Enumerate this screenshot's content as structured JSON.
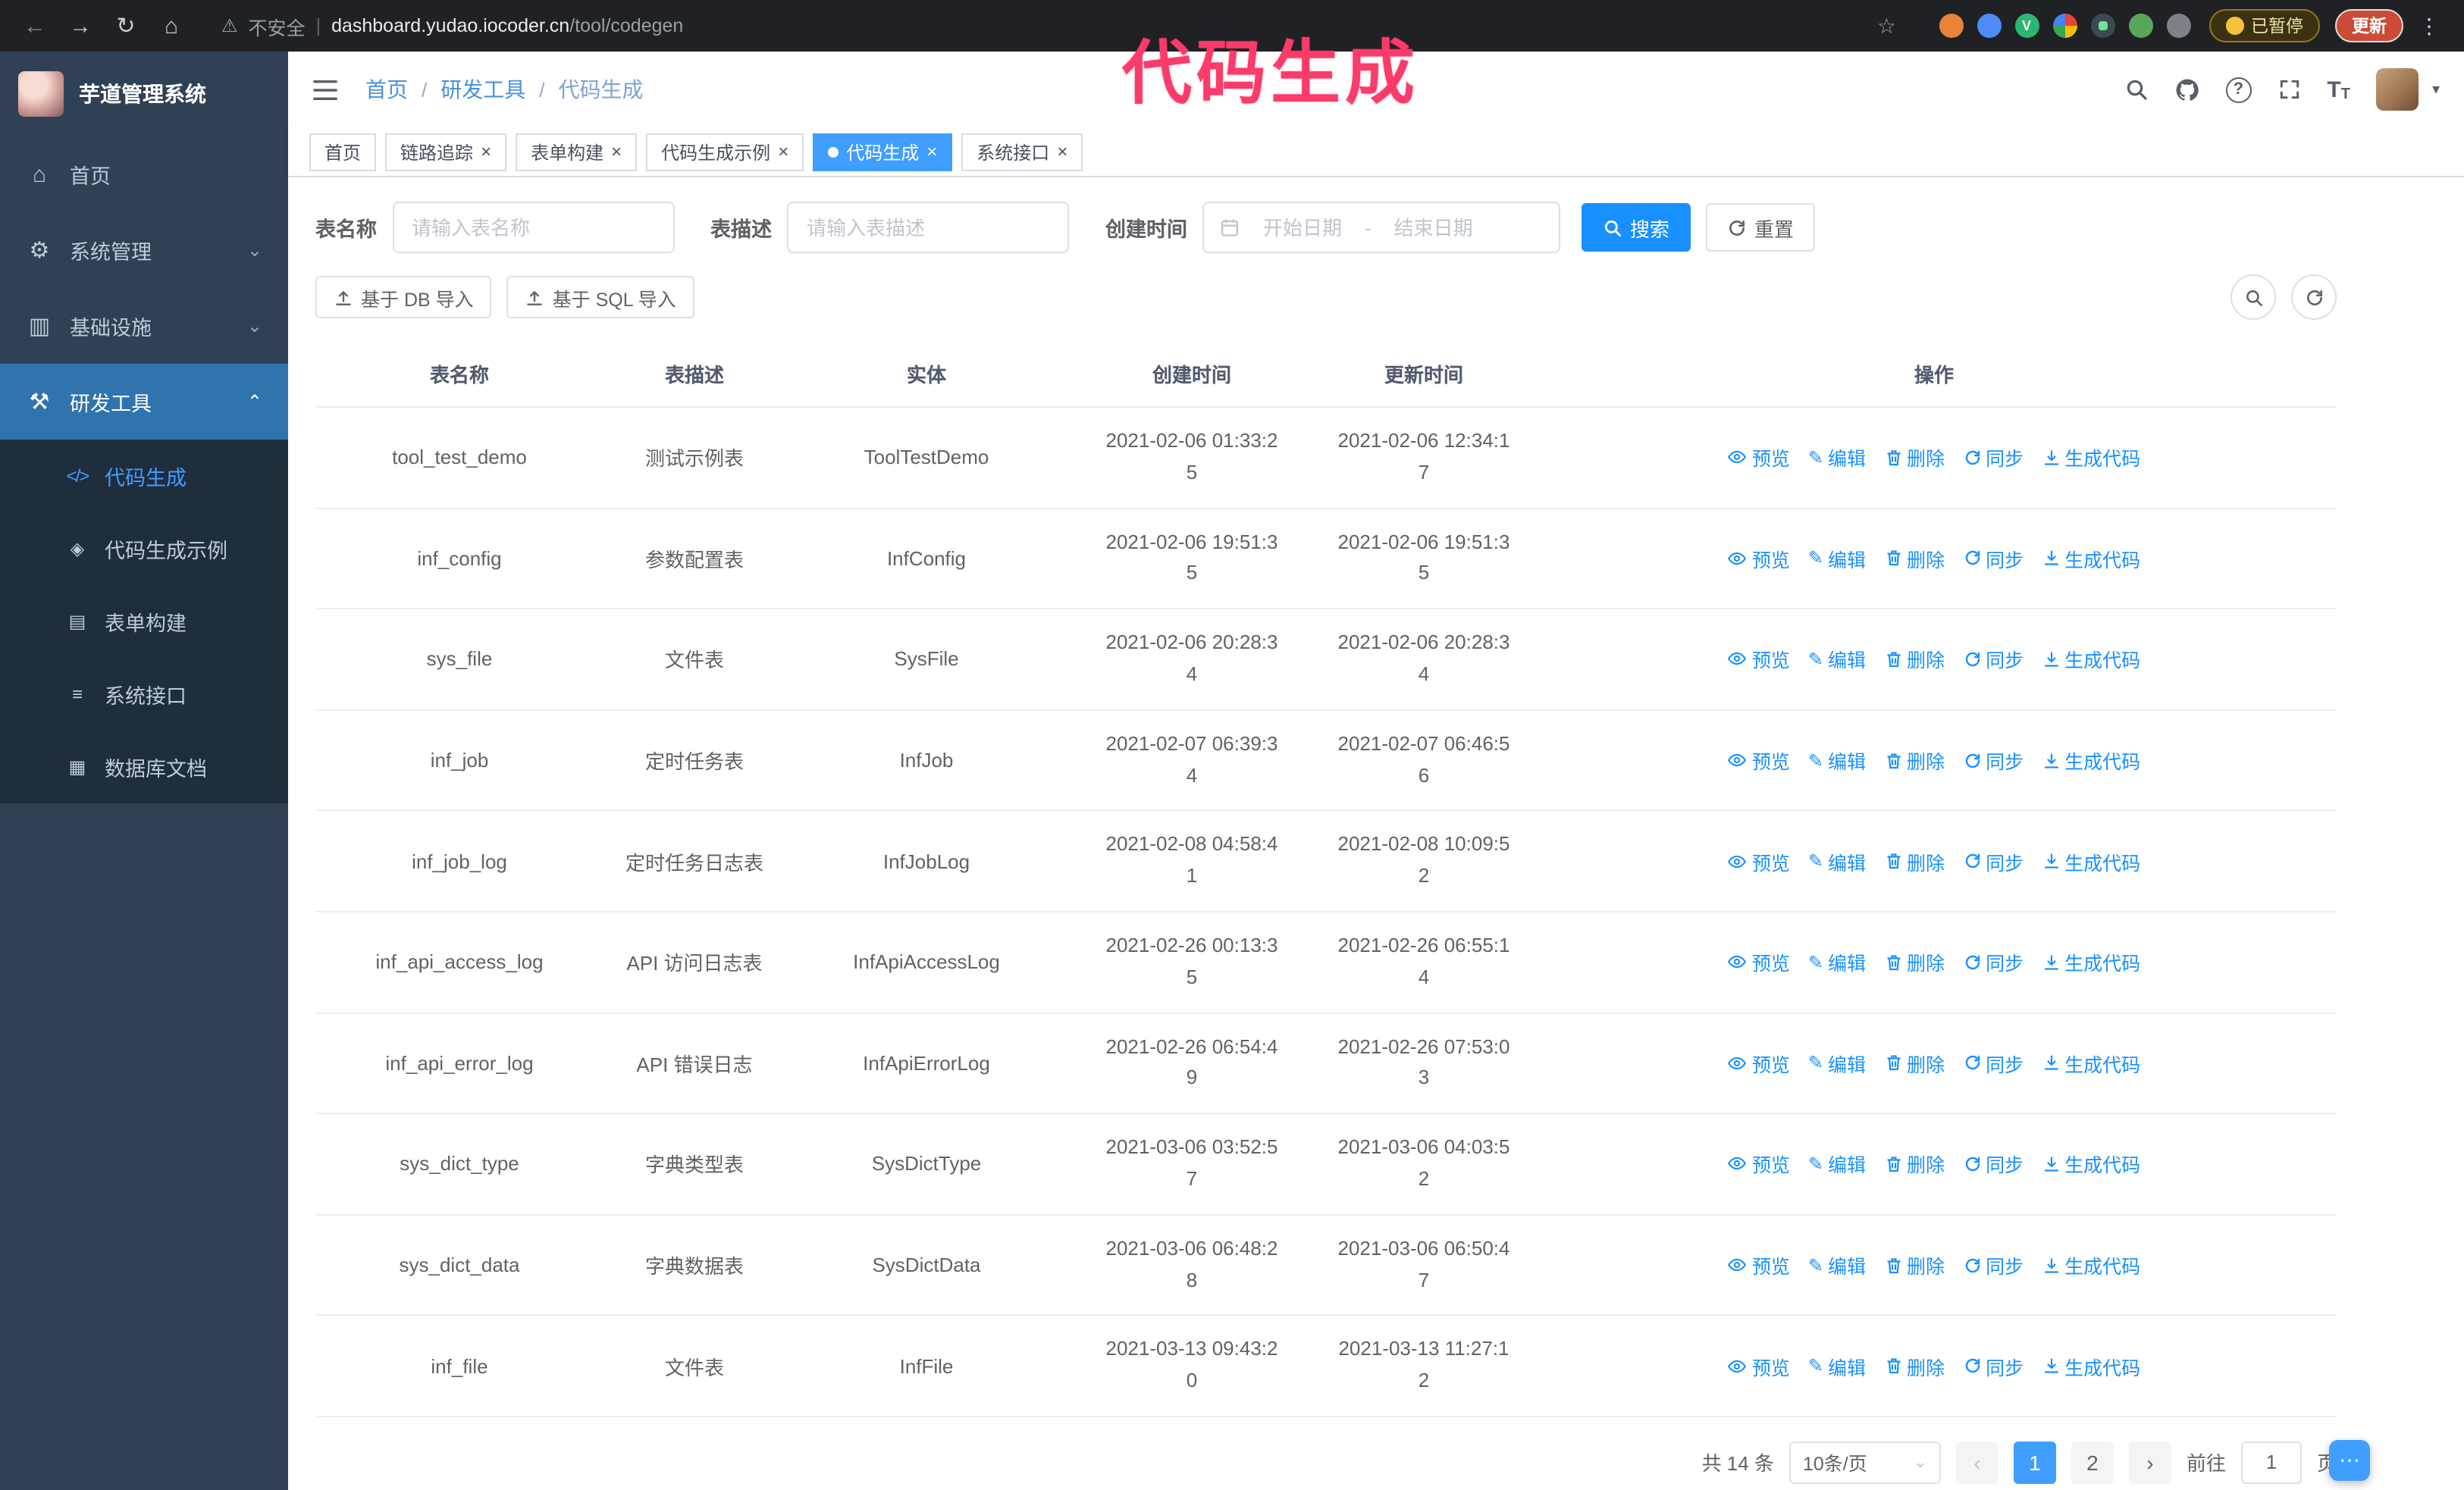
{
  "annotation": "代码生成",
  "browser": {
    "security_label": "不安全",
    "url_host": "dashboard.yudao.iocoder.cn",
    "url_path": "/tool/codegen",
    "paused_label": "已暂停",
    "update_label": "更新"
  },
  "sidebar": {
    "logo_title": "芋道管理系统",
    "menu": [
      {
        "label": "首页"
      },
      {
        "label": "系统管理"
      },
      {
        "label": "基础设施"
      },
      {
        "label": "研发工具"
      }
    ],
    "submenu": [
      {
        "label": "代码生成"
      },
      {
        "label": "代码生成示例"
      },
      {
        "label": "表单构建"
      },
      {
        "label": "系统接口"
      },
      {
        "label": "数据库文档"
      }
    ]
  },
  "header": {
    "breadcrumb": [
      "首页",
      "研发工具",
      "代码生成"
    ]
  },
  "tabs": [
    "首页",
    "链路追踪",
    "表单构建",
    "代码生成示例",
    "代码生成",
    "系统接口"
  ],
  "filters": {
    "table_name_label": "表名称",
    "table_name_placeholder": "请输入表名称",
    "table_desc_label": "表描述",
    "table_desc_placeholder": "请输入表描述",
    "create_time_label": "创建时间",
    "start_date_placeholder": "开始日期",
    "date_separator": "-",
    "end_date_placeholder": "结束日期",
    "search_label": "搜索",
    "reset_label": "重置"
  },
  "toolbar": {
    "import_db_label": "基于 DB 导入",
    "import_sql_label": "基于 SQL 导入"
  },
  "table": {
    "columns": [
      "表名称",
      "表描述",
      "实体",
      "创建时间",
      "更新时间",
      "操作"
    ],
    "actions": [
      "预览",
      "编辑",
      "删除",
      "同步",
      "生成代码"
    ],
    "rows": [
      {
        "name": "tool_test_demo",
        "desc": "测试示例表",
        "entity": "ToolTestDemo",
        "created": "2021-02-06 01:33:25",
        "updated": "2021-02-06 12:34:17"
      },
      {
        "name": "inf_config",
        "desc": "参数配置表",
        "entity": "InfConfig",
        "created": "2021-02-06 19:51:35",
        "updated": "2021-02-06 19:51:35"
      },
      {
        "name": "sys_file",
        "desc": "文件表",
        "entity": "SysFile",
        "created": "2021-02-06 20:28:34",
        "updated": "2021-02-06 20:28:34"
      },
      {
        "name": "inf_job",
        "desc": "定时任务表",
        "entity": "InfJob",
        "created": "2021-02-07 06:39:34",
        "updated": "2021-02-07 06:46:56"
      },
      {
        "name": "inf_job_log",
        "desc": "定时任务日志表",
        "entity": "InfJobLog",
        "created": "2021-02-08 04:58:41",
        "updated": "2021-02-08 10:09:52"
      },
      {
        "name": "inf_api_access_log",
        "desc": "API 访问日志表",
        "entity": "InfApiAccessLog",
        "created": "2021-02-26 00:13:35",
        "updated": "2021-02-26 06:55:14"
      },
      {
        "name": "inf_api_error_log",
        "desc": "API 错误日志",
        "entity": "InfApiErrorLog",
        "created": "2021-02-26 06:54:49",
        "updated": "2021-02-26 07:53:03"
      },
      {
        "name": "sys_dict_type",
        "desc": "字典类型表",
        "entity": "SysDictType",
        "created": "2021-03-06 03:52:57",
        "updated": "2021-03-06 04:03:52"
      },
      {
        "name": "sys_dict_data",
        "desc": "字典数据表",
        "entity": "SysDictData",
        "created": "2021-03-06 06:48:28",
        "updated": "2021-03-06 06:50:47"
      },
      {
        "name": "inf_file",
        "desc": "文件表",
        "entity": "InfFile",
        "created": "2021-03-13 09:43:20",
        "updated": "2021-03-13 11:27:12"
      }
    ]
  },
  "pagination": {
    "total": "共 14 条",
    "page_size": "10条/页",
    "page_1": "1",
    "page_2": "2",
    "goto_label": "前往",
    "goto_value": "1",
    "unit_label": "页"
  },
  "icons": {
    "back": "←",
    "forward": "→",
    "reload": "↻",
    "home": "⌂",
    "warning": "⚠",
    "pipe": "|",
    "star": "☆",
    "kebab": "⋮",
    "help": "?",
    "caret_down": "▾",
    "chevron_down": "⌄",
    "chevron_up": "⌃",
    "breadcrumb_sep": "/",
    "close": "×",
    "pencil": "✎",
    "prev": "‹",
    "next": "›",
    "font_size_large": "T",
    "font_size_small": "T",
    "ext_v": "V",
    "menu_home": "⌂",
    "menu_system": "⚙",
    "menu_infra": "▥",
    "menu_tools": "⚒",
    "menu_codegen": "</>",
    "menu_example": "◈",
    "menu_form": "▤",
    "menu_api": "≡",
    "menu_db": "▦",
    "float": "⋯"
  },
  "colors": {
    "primary": "#409eff",
    "link": "#1890ff",
    "annotation_pink": "#fb3b69",
    "sidebar_bg": "#304156",
    "submenu_bg": "#1f2d3d",
    "active_tab_bg": "#409eff",
    "chrome_bg": "#202124"
  }
}
